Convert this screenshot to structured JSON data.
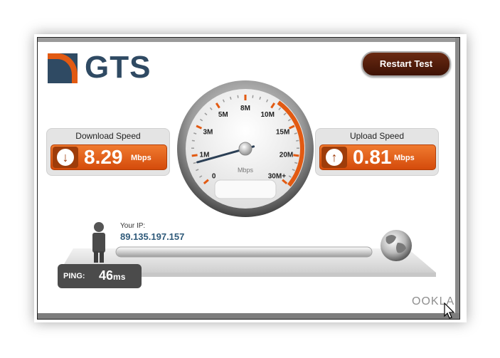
{
  "brand": {
    "name": "GTS",
    "logo_color": "#2f4a63",
    "accent": "#e25a12"
  },
  "toolbar": {
    "restart_label": "Restart Test"
  },
  "download": {
    "title": "Download Speed",
    "value": "8.29",
    "unit": "Mbps",
    "icon": "arrow-down-icon"
  },
  "upload": {
    "title": "Upload Speed",
    "value": "0.81",
    "unit": "Mbps",
    "icon": "arrow-up-icon"
  },
  "gauge": {
    "unit": "Mbps",
    "needle_value_mbps": 0.75,
    "ticks": [
      {
        "label": "0",
        "value": 0
      },
      {
        "label": "1M",
        "value": 1
      },
      {
        "label": "3M",
        "value": 3
      },
      {
        "label": "5M",
        "value": 5
      },
      {
        "label": "8M",
        "value": 8
      },
      {
        "label": "10M",
        "value": 10
      },
      {
        "label": "15M",
        "value": 15
      },
      {
        "label": "20M",
        "value": 20
      },
      {
        "label": "30M+",
        "value": 30
      }
    ]
  },
  "ip": {
    "label": "Your IP:",
    "value": "89.135.197.157"
  },
  "ping": {
    "label": "PING:",
    "value": "46",
    "unit": "ms"
  },
  "footer": {
    "vendor": "OOKLA"
  }
}
